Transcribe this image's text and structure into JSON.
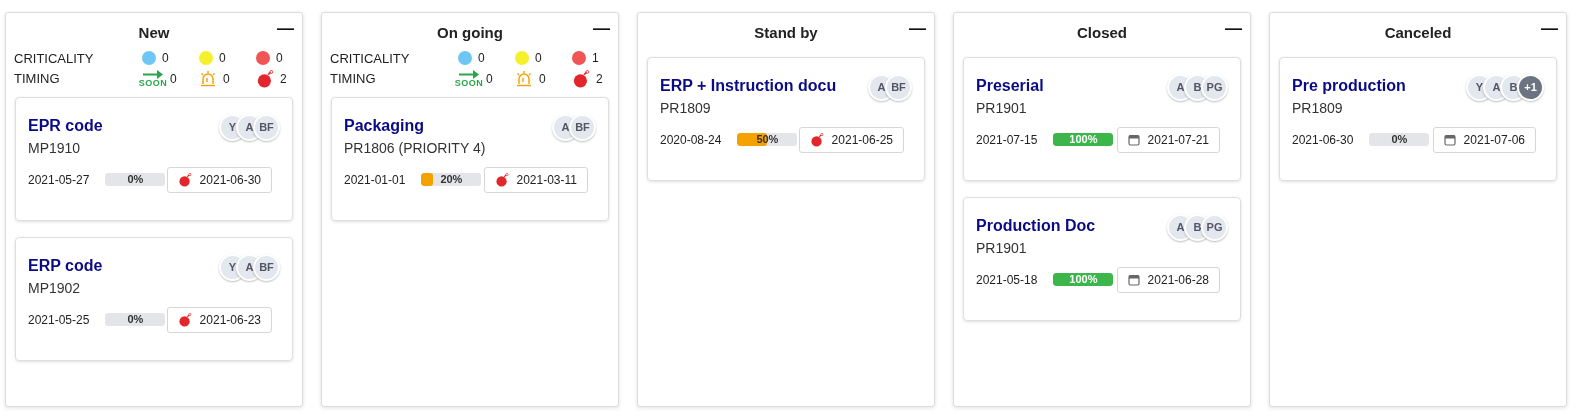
{
  "columns": [
    {
      "title": "New",
      "collapse": "—",
      "summary": {
        "criticality_label": "CRITICALITY",
        "criticality": [
          {
            "color": "#6ec6f5",
            "count": "0"
          },
          {
            "color": "#f5f02a",
            "count": "0"
          },
          {
            "color": "#f25555",
            "count": "0"
          }
        ],
        "timing_label": "TIMING",
        "timing": [
          {
            "kind": "soon",
            "icon_text": "SOON",
            "count": "0"
          },
          {
            "kind": "alarm",
            "count": "0"
          },
          {
            "kind": "bomb",
            "count": "2"
          }
        ]
      },
      "cards": [
        {
          "title": "EPR code",
          "code": "MP1910",
          "avatars": [
            {
              "text": "Y",
              "kind": "person"
            },
            {
              "text": "A",
              "kind": "person"
            },
            {
              "text": "BF",
              "kind": "person"
            }
          ],
          "start": "2021-05-27",
          "progress": {
            "level": 0,
            "text": "0%"
          },
          "due": {
            "kind": "overdue",
            "date": "2021-06-30"
          }
        },
        {
          "title": "ERP code",
          "code": "MP1902",
          "avatars": [
            {
              "text": "Y",
              "kind": "person"
            },
            {
              "text": "A",
              "kind": "person"
            },
            {
              "text": "BF",
              "kind": "person"
            }
          ],
          "start": "2021-05-25",
          "progress": {
            "level": 0,
            "text": "0%"
          },
          "due": {
            "kind": "overdue",
            "date": "2021-06-23"
          }
        }
      ]
    },
    {
      "title": "On going",
      "collapse": "—",
      "summary": {
        "criticality_label": "CRITICALITY",
        "criticality": [
          {
            "color": "#6ec6f5",
            "count": "0"
          },
          {
            "color": "#f5f02a",
            "count": "0"
          },
          {
            "color": "#f25555",
            "count": "1"
          }
        ],
        "timing_label": "TIMING",
        "timing": [
          {
            "kind": "soon",
            "icon_text": "SOON",
            "count": "0"
          },
          {
            "kind": "alarm",
            "count": "0"
          },
          {
            "kind": "bomb",
            "count": "2"
          }
        ]
      },
      "cards": [
        {
          "title": "Packaging",
          "code": "PR1806 (PRIORITY 4)",
          "avatars": [
            {
              "text": "A",
              "kind": "person"
            },
            {
              "text": "BF",
              "kind": "person"
            }
          ],
          "start": "2021-01-01",
          "progress": {
            "level": 0.2,
            "text": "20%"
          },
          "due": {
            "kind": "overdue",
            "date": "2021-03-11"
          }
        }
      ]
    },
    {
      "title": "Stand by",
      "collapse": "—",
      "cards": [
        {
          "title": "ERP + Instruction docu",
          "code": "PR1809",
          "avatars": [
            {
              "text": "A",
              "kind": "person"
            },
            {
              "text": "BF",
              "kind": "person"
            }
          ],
          "start": "2020-08-24",
          "progress": {
            "level": 0.5,
            "text": "50%"
          },
          "due": {
            "kind": "overdue",
            "date": "2021-06-25"
          }
        }
      ]
    },
    {
      "title": "Closed",
      "collapse": "—",
      "cards": [
        {
          "title": "Preserial",
          "code": "PR1901",
          "avatars": [
            {
              "text": "A",
              "kind": "person"
            },
            {
              "text": "B",
              "kind": "person"
            },
            {
              "text": "PG",
              "kind": "person"
            }
          ],
          "start": "2021-07-15",
          "progress": {
            "level": 1,
            "text": "100%"
          },
          "due": {
            "kind": "planned",
            "date": "2021-07-21"
          }
        },
        {
          "title": "Production Doc",
          "code": "PR1901",
          "avatars": [
            {
              "text": "A",
              "kind": "person"
            },
            {
              "text": "B",
              "kind": "person"
            },
            {
              "text": "PG",
              "kind": "person"
            }
          ],
          "start": "2021-05-18",
          "progress": {
            "level": 1,
            "text": "100%"
          },
          "due": {
            "kind": "planned",
            "date": "2021-06-28"
          }
        }
      ]
    },
    {
      "title": "Canceled",
      "collapse": "—",
      "cards": [
        {
          "title": "Pre production",
          "code": "PR1809",
          "avatars": [
            {
              "text": "Y",
              "kind": "person"
            },
            {
              "text": "A",
              "kind": "person"
            },
            {
              "text": "B",
              "kind": "person"
            },
            {
              "text": "+1",
              "kind": "more"
            }
          ],
          "start": "2021-06-30",
          "progress": {
            "level": 0,
            "text": "0%"
          },
          "due": {
            "kind": "planned",
            "date": "2021-07-06"
          }
        }
      ]
    }
  ]
}
